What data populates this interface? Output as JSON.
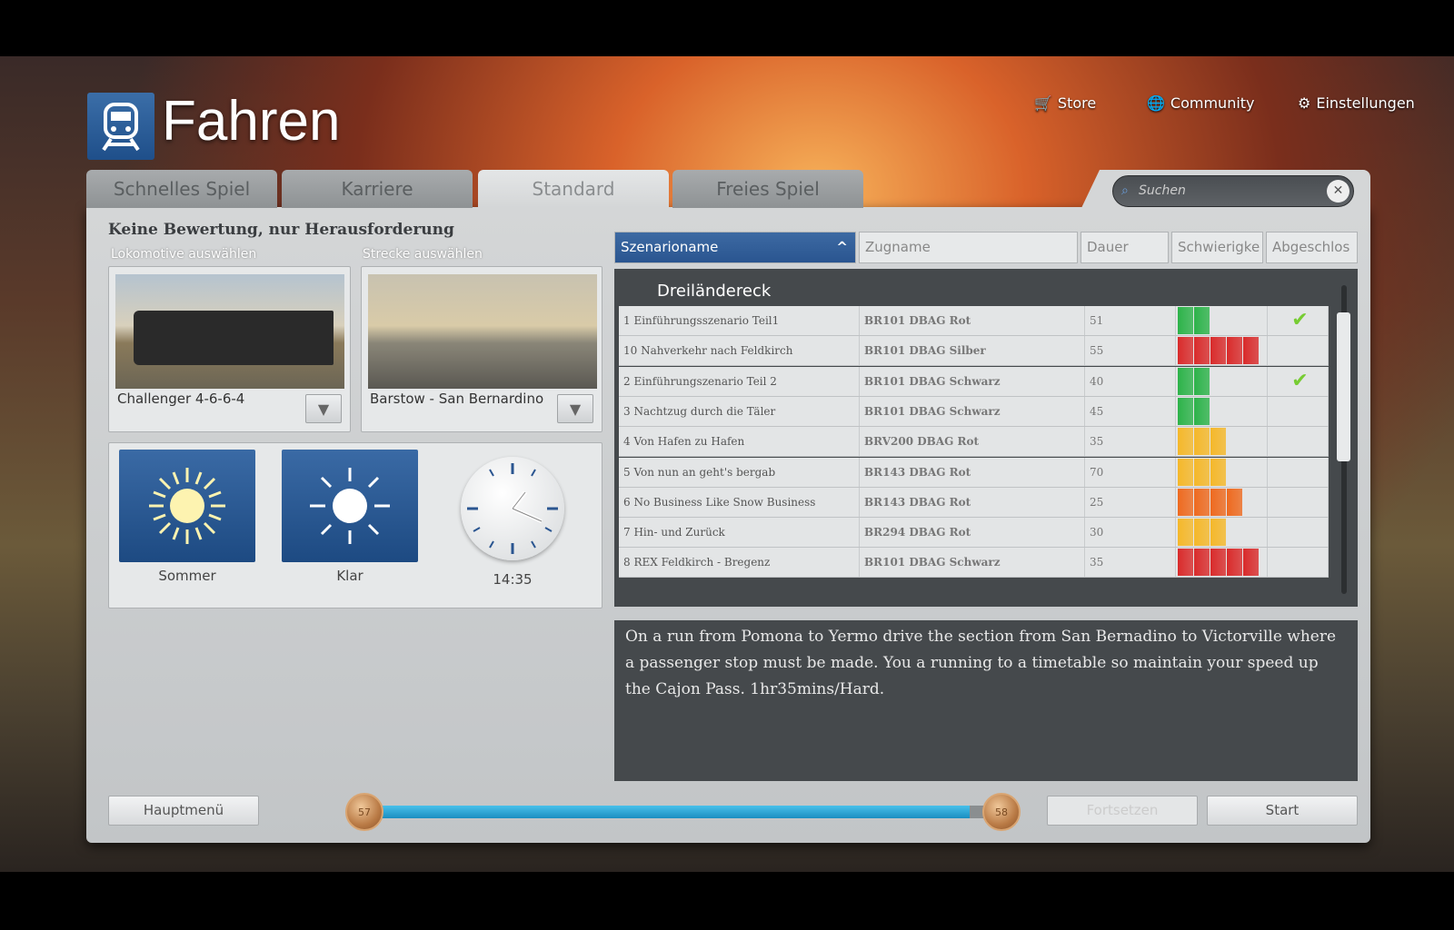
{
  "header": {
    "title": "Fahren",
    "nav": [
      {
        "label": "Store",
        "icon": "cart-icon"
      },
      {
        "label": "Community",
        "icon": "globe-icon"
      },
      {
        "label": "Einstellungen",
        "icon": "gears-icon"
      }
    ]
  },
  "tabs": [
    {
      "label": "Schnelles Spiel"
    },
    {
      "label": "Karriere"
    },
    {
      "label": "Standard",
      "active": true
    },
    {
      "label": "Freies Spiel"
    }
  ],
  "search": {
    "placeholder": "Suchen"
  },
  "left": {
    "heading": "Keine Bewertung, nur Herausforderung",
    "loco_label": "Lokomotive auswählen",
    "loco_name": "Challenger 4-6-6-4",
    "route_label": "Strecke auswählen",
    "route_name": "Barstow - San Bernardino",
    "season": "Sommer",
    "weather": "Klar",
    "time": "14:35"
  },
  "table": {
    "columns": [
      "Szenarioname",
      "Zugname",
      "Dauer",
      "Schwierigke",
      "Abgeschlos"
    ],
    "group": "Dreiländereck",
    "rows": [
      {
        "name": "1 Einführungsszenario Teil1",
        "train": "BR101 DBAG Rot",
        "duration": "51",
        "difficulty": 2,
        "done": true
      },
      {
        "name": "10 Nahverkehr nach Feldkirch",
        "train": "BR101 DBAG Silber",
        "duration": "55",
        "difficulty": 5,
        "done": false
      },
      {
        "name": "2 Einführungszenario Teil 2",
        "train": "BR101 DBAG Schwarz",
        "duration": "40",
        "difficulty": 2,
        "done": true
      },
      {
        "name": "3 Nachtzug durch die Täler",
        "train": "BR101 DBAG Schwarz",
        "duration": "45",
        "difficulty": 2,
        "done": false
      },
      {
        "name": "4 Von Hafen zu Hafen",
        "train": "BRV200 DBAG Rot",
        "duration": "35",
        "difficulty": 3,
        "done": false
      },
      {
        "name": "5 Von nun an geht's bergab",
        "train": "BR143 DBAG Rot",
        "duration": "70",
        "difficulty": 3,
        "done": false
      },
      {
        "name": "6 No Business Like Snow Business",
        "train": "BR143 DBAG Rot",
        "duration": "25",
        "difficulty": 4,
        "done": false
      },
      {
        "name": "7 Hin- und Zurück",
        "train": "BR294 DBAG Rot",
        "duration": "30",
        "difficulty": 3,
        "done": false
      },
      {
        "name": "8 REX Feldkirch - Bregenz",
        "train": "BR101 DBAG Schwarz",
        "duration": "35",
        "difficulty": 5,
        "done": false
      }
    ]
  },
  "description": "On a run from Pomona to Yermo drive the section from San Bernadino to Victorville where a passenger stop must be made.  You a running to a timetable so maintain your speed up the Cajon Pass. 1hr35mins/Hard.",
  "footer": {
    "main_menu": "Hauptmenü",
    "level_current": "57",
    "level_next": "58",
    "progress_percent": 93,
    "continue": "Fortsetzen",
    "start": "Start"
  },
  "colors": {
    "accent": "#2a5590",
    "progress": "#1fa0d0",
    "d2": "#2db34a",
    "d3": "#f5b82a",
    "d4": "#ee6a1f",
    "d5": "#d92b2b"
  }
}
